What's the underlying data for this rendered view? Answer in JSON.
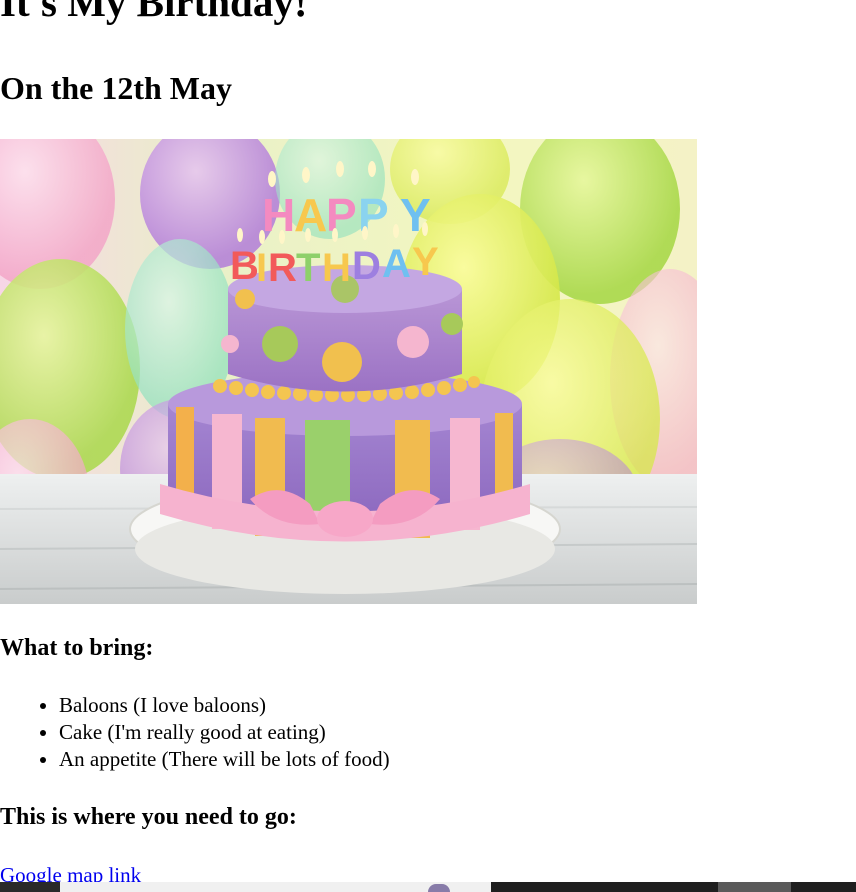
{
  "heading": {
    "title": "It's My Birthday!",
    "date": "On the 12th May"
  },
  "image": {
    "alt": "Two-tier birthday cake with HAPPY BIRTHDAY candles in front of colorful balloons",
    "candles_top": "HAPPY",
    "candles_bottom": "BIRTHDAY"
  },
  "bring": {
    "heading": "What to bring:",
    "items": [
      "Baloons (I love baloons)",
      "Cake (I'm really good at eating)",
      "An appetite (There will be lots of food)"
    ]
  },
  "directions": {
    "heading": "This is where you need to go:",
    "link_label": "Google map link"
  },
  "colors": {
    "link": "#0000ee",
    "text": "#000000",
    "background": "#ffffff"
  }
}
